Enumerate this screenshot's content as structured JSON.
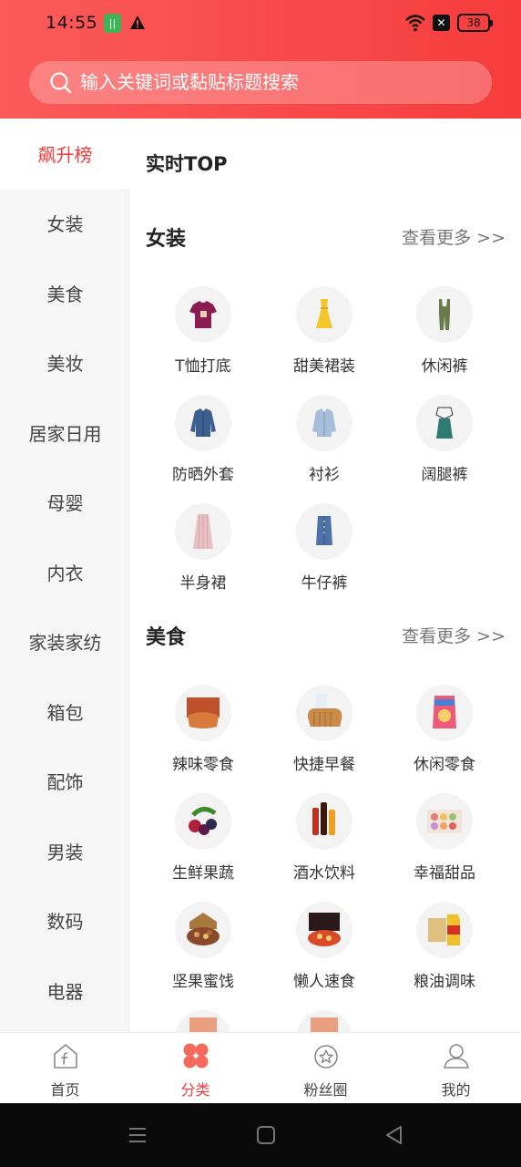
{
  "status_bar": {
    "time": "14:55",
    "battery": "38",
    "app_badge": "|| "
  },
  "search": {
    "placeholder": "输入关键词或黏贴标题搜索"
  },
  "sidebar": {
    "items": [
      {
        "label": "飙升榜",
        "active": true
      },
      {
        "label": "女装"
      },
      {
        "label": "美食"
      },
      {
        "label": "美妆"
      },
      {
        "label": "居家日用"
      },
      {
        "label": "母婴"
      },
      {
        "label": "内衣"
      },
      {
        "label": "家装家纺"
      },
      {
        "label": "箱包"
      },
      {
        "label": "配饰"
      },
      {
        "label": "男装"
      },
      {
        "label": "数码"
      },
      {
        "label": "电器"
      }
    ]
  },
  "main": {
    "realtime_title": "实时TOP",
    "sections": [
      {
        "title": "女装",
        "more": "查看更多 >>",
        "items": [
          {
            "label": "T恤打底",
            "icon": "tshirt-icon"
          },
          {
            "label": "甜美裙装",
            "icon": "dress-icon"
          },
          {
            "label": "休闲裤",
            "icon": "jumpsuit-icon"
          },
          {
            "label": "防晒外套",
            "icon": "denim-jacket-icon"
          },
          {
            "label": "衬衫",
            "icon": "shirt-icon"
          },
          {
            "label": "阔腿裤",
            "icon": "wide-pants-icon"
          },
          {
            "label": "半身裙",
            "icon": "skirt-icon"
          },
          {
            "label": "牛仔裤",
            "icon": "denim-skirt-icon"
          }
        ]
      },
      {
        "title": "美食",
        "more": "查看更多 >>",
        "items": [
          {
            "label": "辣味零食",
            "icon": "spicy-snack-icon"
          },
          {
            "label": "快捷早餐",
            "icon": "bread-icon"
          },
          {
            "label": "休闲零食",
            "icon": "chips-icon"
          },
          {
            "label": "生鲜果蔬",
            "icon": "berries-icon"
          },
          {
            "label": "酒水饮料",
            "icon": "drinks-icon"
          },
          {
            "label": "幸福甜品",
            "icon": "macaron-icon"
          },
          {
            "label": "坚果蜜饯",
            "icon": "nuts-icon"
          },
          {
            "label": "懒人速食",
            "icon": "instant-food-icon"
          },
          {
            "label": "粮油调味",
            "icon": "oil-icon"
          }
        ]
      }
    ]
  },
  "tabbar": {
    "tabs": [
      {
        "label": "首页"
      },
      {
        "label": "分类",
        "active": true
      },
      {
        "label": "粉丝圈"
      },
      {
        "label": "我的"
      }
    ]
  },
  "colors": {
    "brand": "#f03c3c",
    "header": "#f94848",
    "sidebar_bg": "#f6f6f6"
  }
}
